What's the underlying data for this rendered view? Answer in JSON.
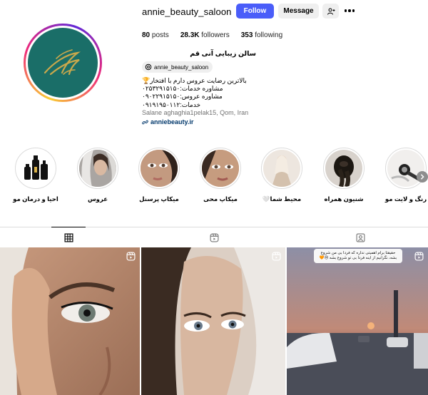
{
  "profile": {
    "username": "annie_beauty_saloon",
    "follow_label": "Follow",
    "message_label": "Message",
    "stats": {
      "posts": "80",
      "posts_label": "posts",
      "followers": "28.3K",
      "followers_label": "followers",
      "following": "353",
      "following_label": "following"
    },
    "full_name": "سالن زیبایی آنی قم",
    "threads_handle": "annie_beauty_saloon",
    "bio": [
      "بالاترین رضایت عروس دارم با افتخار🏆",
      "مشاوره خدمات:۰۲۵۳۲۹۱۵۱۵۰",
      "مشاوره عروس:۰۹۰۲۲۹۱۵۱۵۰",
      "خدمات:۰۹۱۹۱۹۵۰۱۱۲"
    ],
    "address": "Salane aghaghia1pelak15, Qom, Iran",
    "link": "anniebeauty.ir"
  },
  "highlights": [
    {
      "label": "رنگ و لایت مو",
      "icon": "hair-color-thumbnail"
    },
    {
      "label": "شنیون همراه",
      "icon": "hairstyle-thumbnail"
    },
    {
      "label": "محیط شما🤍",
      "icon": "bride-silhouette-thumbnail"
    },
    {
      "label": "میکاپ محی",
      "icon": "makeup-face-thumbnail"
    },
    {
      "label": "میکاپ پرسنل",
      "icon": "makeup-portrait-thumbnail"
    },
    {
      "label": "عروس",
      "icon": "bride-veil-thumbnail"
    },
    {
      "label": "احیا و درمان مو",
      "icon": "hair-products-thumbnail"
    }
  ],
  "tabs": [
    {
      "name": "posts",
      "icon": "grid-icon",
      "active": true
    },
    {
      "name": "reels",
      "icon": "reels-icon",
      "active": false
    },
    {
      "name": "tagged",
      "icon": "tagged-icon",
      "active": false
    }
  ],
  "posts": [
    {
      "caption": "حقیقتا برام اهمیتی نداره که فردا بی من شروع بشه، نگرانیم از اینه فردا بی تو شروع بشه 😔🧡"
    }
  ],
  "colors": {
    "follow": "#4a5df9",
    "avatar_bg": "#1a6e68",
    "link": "#00376b",
    "logo_gold": "#c9a84c"
  }
}
